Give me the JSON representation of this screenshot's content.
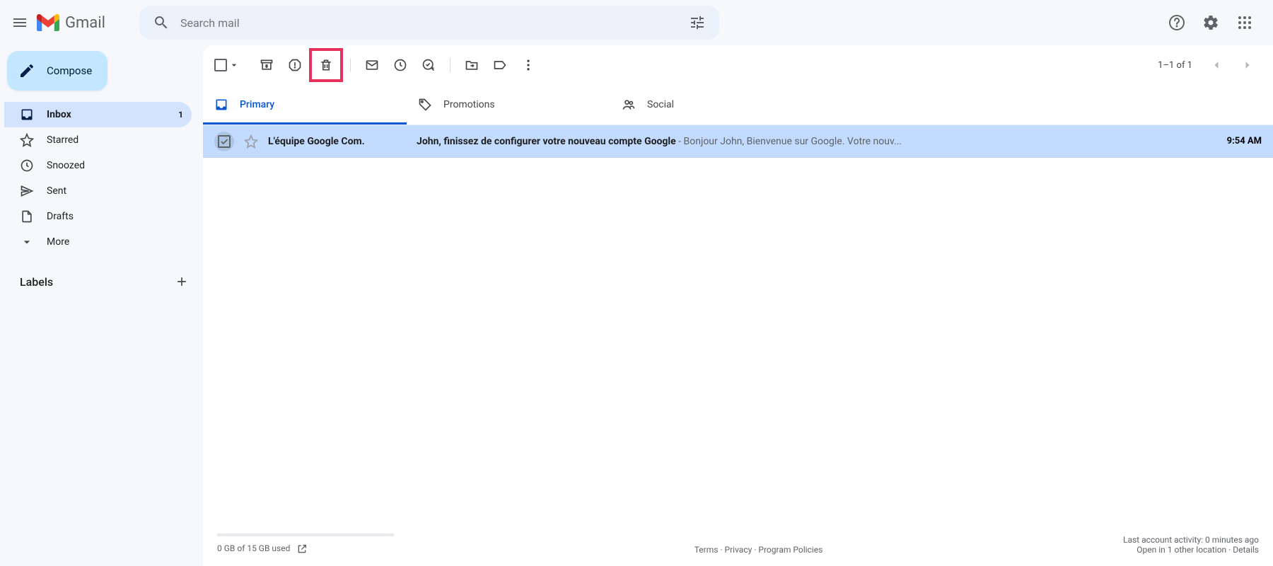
{
  "header": {
    "logo_text": "Gmail",
    "search_placeholder": "Search mail"
  },
  "compose_label": "Compose",
  "sidebar": {
    "items": [
      {
        "label": "Inbox",
        "count": "1"
      },
      {
        "label": "Starred"
      },
      {
        "label": "Snoozed"
      },
      {
        "label": "Sent"
      },
      {
        "label": "Drafts"
      },
      {
        "label": "More"
      }
    ],
    "labels_header": "Labels"
  },
  "toolbar": {
    "pager": "1–1 of 1"
  },
  "tabs": [
    {
      "label": "Primary"
    },
    {
      "label": "Promotions"
    },
    {
      "label": "Social"
    }
  ],
  "emails": [
    {
      "sender": "L'équipe Google Com.",
      "subject": "John, finissez de configurer votre nouveau compte Google",
      "snippet_sep": " - ",
      "snippet": "Bonjour John, Bienvenue sur Google. Votre nouv...",
      "time": "9:54 AM"
    }
  ],
  "footer": {
    "storage": "0 GB of 15 GB used",
    "terms": "Terms",
    "privacy": "Privacy",
    "policies": "Program Policies",
    "sep": " · ",
    "activity": "Last account activity: 0 minutes ago",
    "open_other": "Open in 1 other location",
    "details": "Details"
  }
}
